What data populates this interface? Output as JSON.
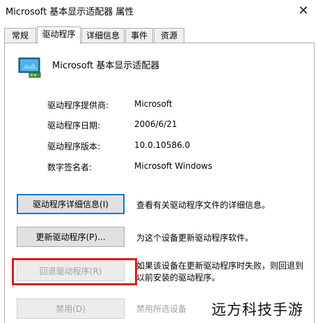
{
  "window": {
    "title": "Microsoft 基本显示适配器 属性",
    "close_glyph": "✕"
  },
  "tabs": [
    {
      "label": "常规",
      "active": false
    },
    {
      "label": "驱动程序",
      "active": true
    },
    {
      "label": "详细信息",
      "active": false
    },
    {
      "label": "事件",
      "active": false
    },
    {
      "label": "资源",
      "active": false
    }
  ],
  "device": {
    "name": "Microsoft 基本显示适配器",
    "icon": "display-adapter-icon"
  },
  "properties": [
    {
      "label": "驱动程序提供商:",
      "value": "Microsoft"
    },
    {
      "label": "驱动程序日期:",
      "value": "2006/6/21"
    },
    {
      "label": "驱动程序版本:",
      "value": "10.0.10586.0"
    },
    {
      "label": "数字签名者:",
      "value": "Microsoft Windows"
    }
  ],
  "actions": [
    {
      "button": "驱动程序详细信息(I)",
      "description": "查看有关驱动程序文件的详细信息。",
      "enabled": true
    },
    {
      "button": "更新驱动程序(P)...",
      "description": "为这个设备更新驱动程序软件。",
      "enabled": true
    },
    {
      "button": "回退驱动程序(R)",
      "description": "如果该设备在更新驱动程序时失败，则回退到以前安装的驱动程序。",
      "enabled": false
    },
    {
      "button": "禁用(D)",
      "description": "禁用所选设备",
      "enabled": false
    }
  ],
  "colors": {
    "highlight": "#e0181c",
    "focus": "#0078d7"
  },
  "watermark": "远方科技手游"
}
